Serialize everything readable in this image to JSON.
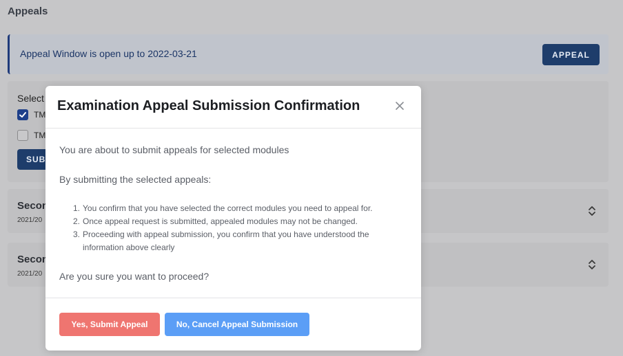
{
  "page": {
    "title": "Appeals"
  },
  "banner": {
    "text": "Appeal Window is open up to 2022-03-21",
    "appeal_button": "APPEAL"
  },
  "selection": {
    "label": "Select",
    "items": [
      {
        "label": "TM",
        "checked": true
      },
      {
        "label": "TM",
        "checked": false
      }
    ],
    "submit_button": "SUB"
  },
  "semesters": [
    {
      "title": "Secon",
      "subtitle": "2021/20"
    },
    {
      "title": "Secon",
      "subtitle": "2021/20"
    }
  ],
  "modal": {
    "title": "Examination Appeal Submission Confirmation",
    "intro": "You are about to submit appeals for selected modules",
    "lead": "By submitting the selected appeals:",
    "points": [
      "You confirm that you have selected the correct modules you need to appeal for.",
      "Once appeal request is submitted, appealed modules may not be changed.",
      "Proceeding with appeal submission, you confirm that you have understood the information above clearly"
    ],
    "question": "Are you sure you want to proceed?",
    "confirm_button": "Yes, Submit Appeal",
    "cancel_button": "No, Cancel Appeal Submission"
  },
  "colors": {
    "primary": "#1e3d6b",
    "danger": "#ef7570",
    "info": "#5b9ef6"
  }
}
